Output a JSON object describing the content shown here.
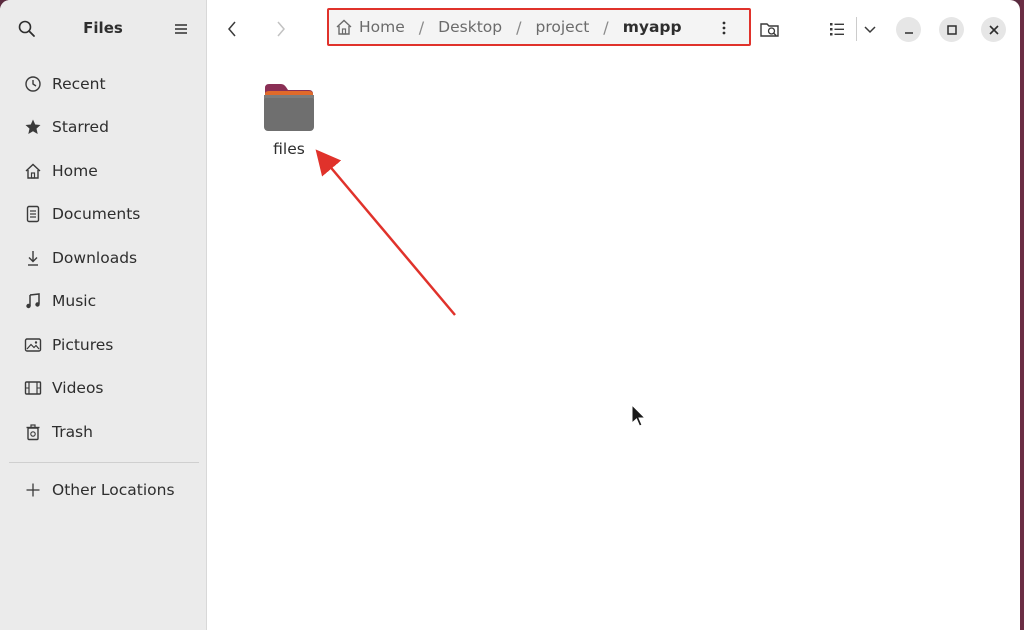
{
  "sidebar": {
    "title": "Files",
    "items": [
      {
        "label": "Recent",
        "icon": "clock-icon"
      },
      {
        "label": "Starred",
        "icon": "star-icon"
      },
      {
        "label": "Home",
        "icon": "home-icon"
      },
      {
        "label": "Documents",
        "icon": "document-icon"
      },
      {
        "label": "Downloads",
        "icon": "download-icon"
      },
      {
        "label": "Music",
        "icon": "music-icon"
      },
      {
        "label": "Pictures",
        "icon": "picture-icon"
      },
      {
        "label": "Videos",
        "icon": "video-icon"
      },
      {
        "label": "Trash",
        "icon": "trash-icon"
      }
    ],
    "other_locations": "Other Locations"
  },
  "pathbar": {
    "crumbs": [
      "Home",
      "Desktop",
      "project",
      "myapp"
    ],
    "active_crumb": "myapp"
  },
  "content": {
    "items": [
      {
        "label": "files",
        "type": "folder"
      }
    ]
  },
  "colors": {
    "annotation_red": "#e0322b",
    "folder_tab": "#8a2f55",
    "folder_body": "#6f6f6f",
    "sidebar_bg": "#ebebeb"
  }
}
